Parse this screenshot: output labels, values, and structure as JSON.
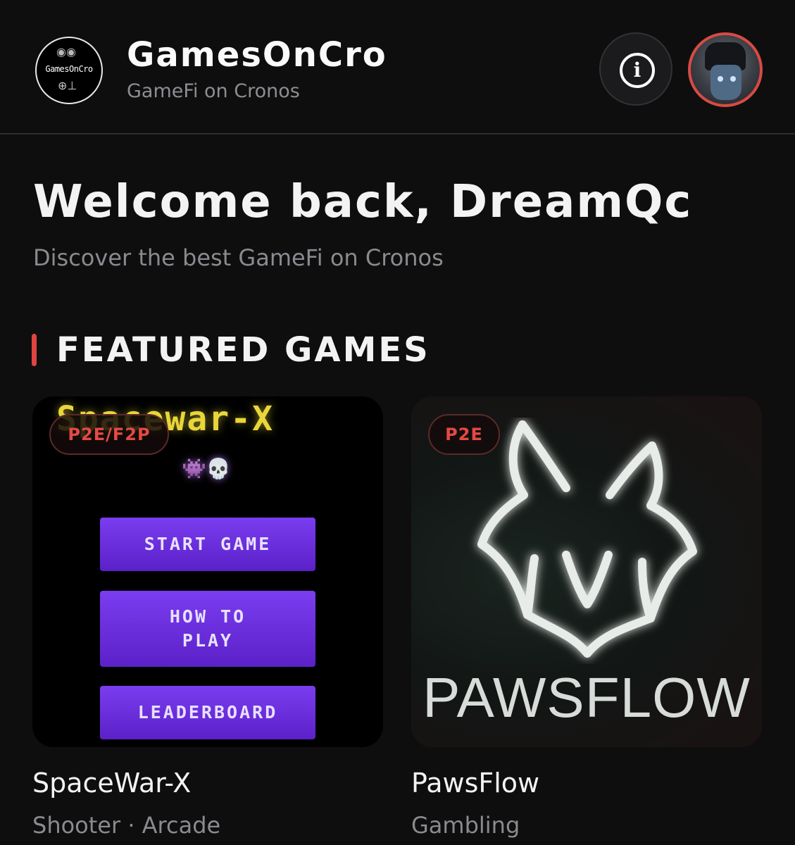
{
  "header": {
    "logo_text": "GamesOnCro",
    "title": "GamesOnCro",
    "subtitle": "GameFi on Cronos",
    "info_icon": "info-icon",
    "avatar_icon": "user-avatar"
  },
  "welcome": {
    "heading": "Welcome back, DreamQc",
    "tagline": "Discover the best GameFi on Cronos"
  },
  "section": {
    "title": "FEATURED GAMES",
    "accent_color": "#e0443e"
  },
  "games": [
    {
      "name": "SpaceWar-X",
      "genre": "Shooter · Arcade",
      "badge": "P2E/F2P",
      "art": {
        "title": "Spacewar-X",
        "emojis": "👾💀",
        "buttons": [
          "START GAME",
          "HOW TO PLAY",
          "LEADERBOARD"
        ]
      }
    },
    {
      "name": "PawsFlow",
      "genre": "Gambling",
      "badge": "P2E",
      "art": {
        "wordmark": "PAWSFLOW"
      }
    }
  ],
  "colors": {
    "background": "#0e0e0f",
    "badge_text": "#e34a43",
    "pixel_button": "#6a2fe0"
  }
}
